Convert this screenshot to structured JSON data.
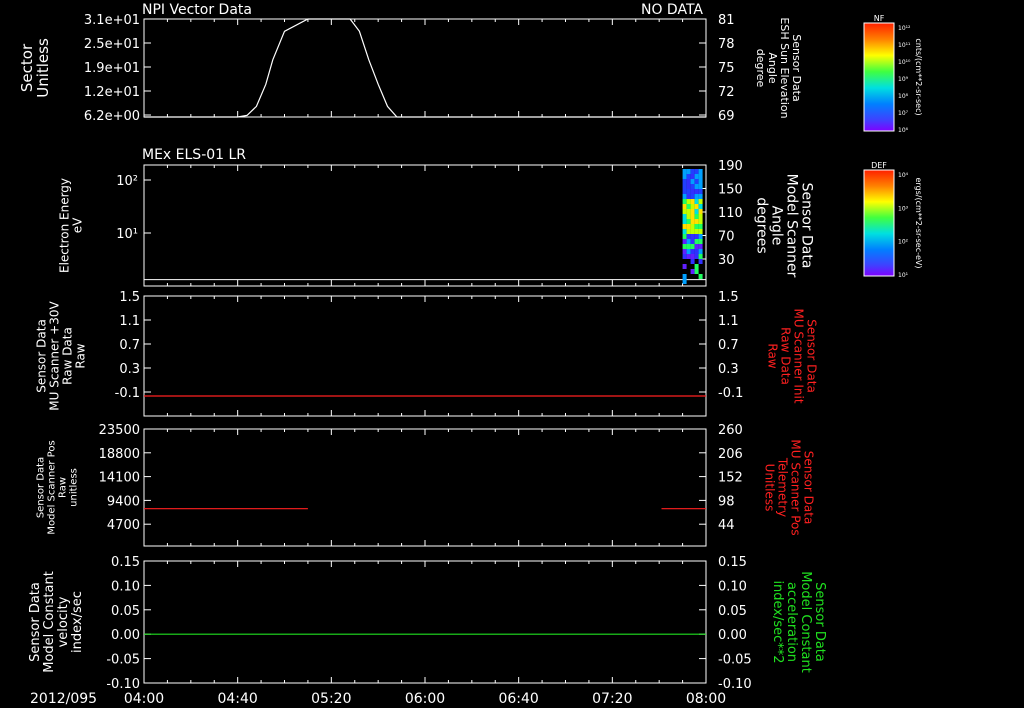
{
  "header": {
    "title": "NPI Vector Data",
    "status": "NO DATA",
    "panel2_title": "MEx ELS-01 LR",
    "date": "2012/095"
  },
  "chart_data": [
    {
      "type": "line",
      "ylabel": [
        "Sector",
        "Unitless"
      ],
      "yticks": [
        "3.1e+01",
        "2.5e+01",
        "1.9e+01",
        "1.2e+01",
        "6.2e+00"
      ],
      "ylabel_right": [
        "Sensor Data",
        "ESH Sun Elevation",
        "Angle",
        "degree"
      ],
      "yticks_right": [
        "81",
        "78",
        "75",
        "72",
        "69"
      ],
      "ylim_right": [
        69,
        81
      ],
      "series": [
        {
          "color": "#ffffff",
          "x": [
            0,
            40,
            44,
            48,
            52,
            55,
            60,
            70,
            80,
            88,
            92,
            96,
            100,
            104,
            108,
            160,
            240
          ],
          "y": [
            69,
            69,
            69.2,
            70.3,
            73.0,
            76.0,
            79.5,
            81,
            81,
            81,
            79.5,
            76.0,
            73.0,
            70.3,
            69,
            69,
            69
          ]
        }
      ]
    },
    {
      "type": "heatmap",
      "ylabel": [
        "Electron Energy",
        "eV"
      ],
      "yticks": [
        "10²",
        "10¹"
      ],
      "ylabel_right": [
        "Sensor Data",
        "Model Scanner",
        "Angle",
        "degrees"
      ],
      "yticks_right": [
        "190",
        "150",
        "110",
        "70",
        "30"
      ],
      "ylim_right": [
        0,
        190
      ],
      "baseline_right": 10,
      "heat_x_start": 230,
      "heat_x_end": 238,
      "colorbar": {
        "label": "DEF",
        "unit": "ergs/(cm**2-sr-sec-eV)",
        "ticks": [
          "10⁴",
          "10³",
          "10²",
          "10¹"
        ]
      }
    },
    {
      "type": "line",
      "ylabel": [
        "Sensor Data",
        "MU Scanner +30V",
        "Raw Data",
        "Raw"
      ],
      "yticks": [
        "1.5",
        "1.1",
        "0.7",
        "0.3",
        "-0.1"
      ],
      "ylim": [
        -0.3,
        1.5
      ],
      "ylabel_right": [
        "Sensor Data",
        "MU Scanner Init",
        "Raw Data",
        "Raw"
      ],
      "yticks_right": [
        "1.5",
        "1.1",
        "0.7",
        "0.3",
        "-0.1"
      ],
      "series": [
        {
          "color": "#ff2020",
          "x": [
            0,
            240
          ],
          "y": [
            0.0,
            0.0
          ]
        }
      ]
    },
    {
      "type": "line",
      "ylabel": [
        "Sensor Data",
        "Model Scanner Pos",
        "Raw",
        "unitless"
      ],
      "yticks": [
        "23500",
        "18800",
        "14100",
        "9400",
        "4700"
      ],
      "ylim": [
        0,
        23500
      ],
      "ylabel_right": [
        "Sensor Data",
        "MU Scanner Pos",
        "Telemetry",
        "Unitless"
      ],
      "yticks_right": [
        "260",
        "206",
        "152",
        "98",
        "44"
      ],
      "series": [
        {
          "color": "#ff2020",
          "x": [
            0,
            70
          ],
          "y": [
            7500,
            7500
          ]
        },
        {
          "color": "#ff2020",
          "x": [
            221,
            240
          ],
          "y": [
            7500,
            7500
          ]
        }
      ]
    },
    {
      "type": "line",
      "ylabel": [
        "Sensor Data",
        "Model Constant",
        "velocity",
        "index/sec"
      ],
      "yticks": [
        "0.15",
        "0.10",
        "0.05",
        "0.00",
        "-0.05",
        "-0.10"
      ],
      "ylim": [
        -0.1,
        0.15
      ],
      "ylabel_right": [
        "Sensor Data",
        "Model Constant",
        "acceleration",
        "index/sec**2"
      ],
      "yticks_right": [
        "0.15",
        "0.10",
        "0.05",
        "0.00",
        "-0.05",
        "-0.10"
      ],
      "series": [
        {
          "color": "#20e020",
          "x": [
            0,
            240
          ],
          "y": [
            0.0,
            0.0
          ]
        }
      ],
      "xticks": [
        "04:00",
        "04:40",
        "05:20",
        "06:00",
        "06:40",
        "07:20",
        "08:00"
      ],
      "xlim": [
        0,
        240
      ]
    }
  ],
  "colorbar_nf": {
    "label": "NF",
    "unit": "cnts/(cm**2-sr-sec)",
    "ticks": [
      "10¹²",
      "10¹¹",
      "10¹⁰",
      "10⁹",
      "10⁸",
      "10⁷",
      "10⁶"
    ]
  },
  "colors": {
    "background": "#000000",
    "axes": "#ffffff",
    "red_series": "#ff2020",
    "green_series": "#20e020"
  }
}
